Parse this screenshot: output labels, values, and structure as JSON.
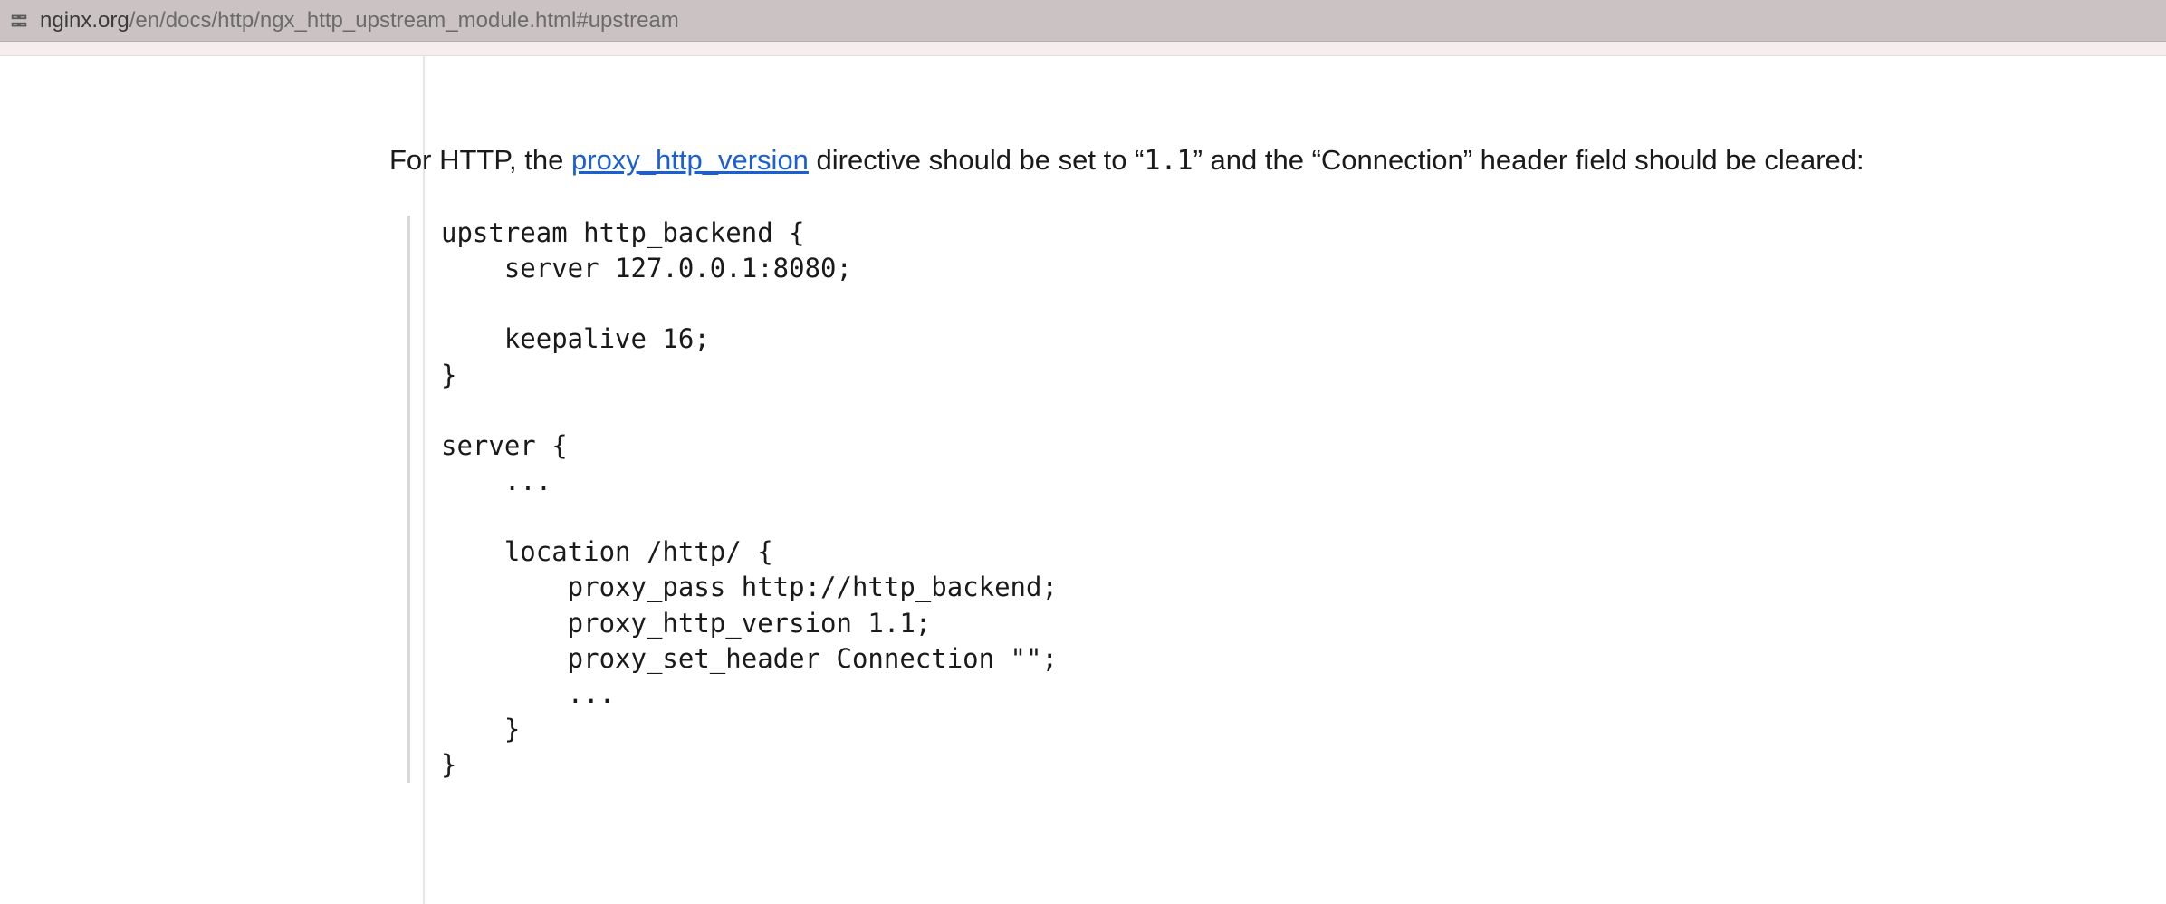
{
  "address_bar": {
    "host": "nginx.org",
    "path": "/en/docs/http/ngx_http_upstream_module.html#upstream"
  },
  "paragraph": {
    "pre_link": "For HTTP, the ",
    "link_text": "proxy_http_version",
    "post_link_before_code": " directive should be set to “",
    "code_value": "1.1",
    "post_code": "” and the “Connection” header field should be cleared:"
  },
  "code_block": "upstream http_backend {\n    server 127.0.0.1:8080;\n\n    keepalive 16;\n}\n\nserver {\n    ...\n\n    location /http/ {\n        proxy_pass http://http_backend;\n        proxy_http_version 1.1;\n        proxy_set_header Connection \"\";\n        ...\n    }\n}"
}
